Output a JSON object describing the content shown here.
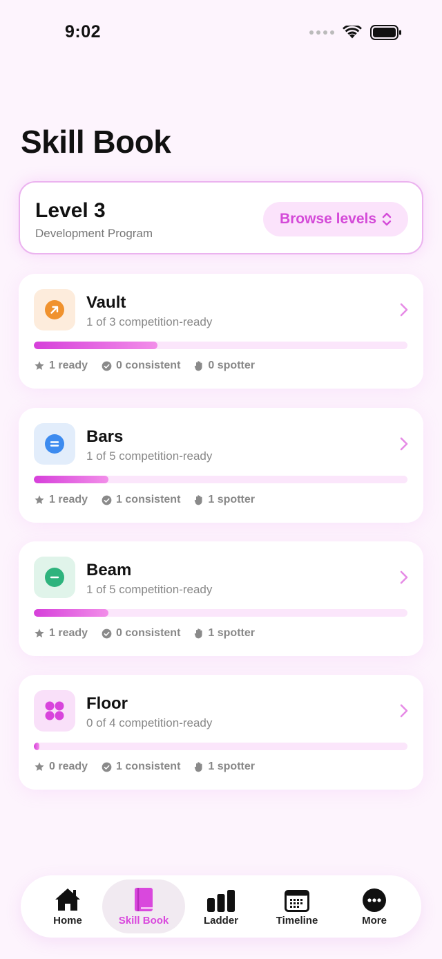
{
  "status_bar": {
    "time": "9:02"
  },
  "page": {
    "title": "Skill Book"
  },
  "level": {
    "title": "Level 3",
    "subtitle": "Development Program",
    "browse_label": "Browse levels"
  },
  "apparatus": [
    {
      "name": "Vault",
      "subtitle": "1 of 3 competition-ready",
      "progress": 0.33,
      "ready": "1 ready",
      "consistent": "0 consistent",
      "spotter": "0 spotter",
      "icon": "arrow-up-right-icon",
      "icon_color": "#f0922e",
      "icon_bg": "#fdecdc"
    },
    {
      "name": "Bars",
      "subtitle": "1 of 5 competition-ready",
      "progress": 0.2,
      "ready": "1 ready",
      "consistent": "1 consistent",
      "spotter": "1 spotter",
      "icon": "equals-icon",
      "icon_color": "#3d8bef",
      "icon_bg": "#e2edfb"
    },
    {
      "name": "Beam",
      "subtitle": "1 of 5 competition-ready",
      "progress": 0.2,
      "ready": "1 ready",
      "consistent": "0 consistent",
      "spotter": "1 spotter",
      "icon": "minus-icon",
      "icon_color": "#2eb37d",
      "icon_bg": "#e0f4ea"
    },
    {
      "name": "Floor",
      "subtitle": "0 of 4 competition-ready",
      "progress": 0.015,
      "ready": "0 ready",
      "consistent": "1 consistent",
      "spotter": "1 spotter",
      "icon": "four-dots-icon",
      "icon_color": "#d845dc",
      "icon_bg": "#f9e0f9"
    }
  ],
  "tabs": [
    {
      "label": "Home",
      "icon": "house-icon"
    },
    {
      "label": "Skill Book",
      "icon": "book-icon",
      "active": true
    },
    {
      "label": "Ladder",
      "icon": "bars-icon"
    },
    {
      "label": "Timeline",
      "icon": "calendar-icon"
    },
    {
      "label": "More",
      "icon": "ellipsis-icon"
    }
  ],
  "colors": {
    "accent": "#d948dd",
    "background": "#fdf4fd",
    "progress_track": "#fbe6fb"
  }
}
